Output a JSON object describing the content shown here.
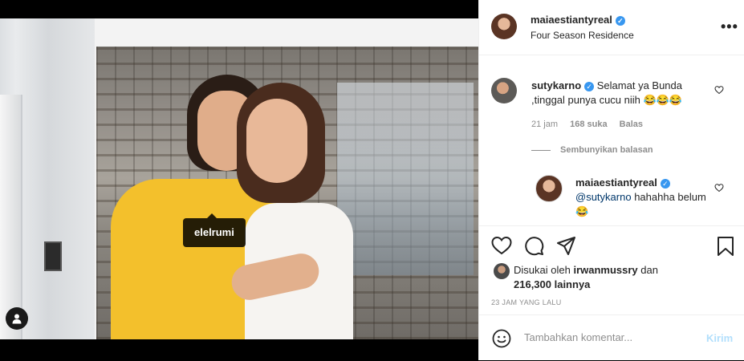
{
  "photo": {
    "tag_label": "elelrumi"
  },
  "header": {
    "username": "maiaestiantyreal",
    "location": "Four Season Residence",
    "more": "•••"
  },
  "comment": {
    "username": "sutykarno",
    "text": "Selamat ya Bunda ,tinggal punya cucu niih 😂😂😂",
    "time": "21 jam",
    "likes": "168 suka",
    "reply": "Balas"
  },
  "hide_replies": "Sembunyikan balasan",
  "reply": {
    "username": "maiaestiantyreal",
    "mention": "@sutykarno",
    "text": "hahahha belum 😂"
  },
  "likes": {
    "prefix": "Disukai oleh",
    "user": "irwanmussry",
    "and": "dan",
    "count": "216,300 lainnya"
  },
  "timestamp": "23 JAM YANG LALU",
  "comment_box": {
    "placeholder": "Tambahkan komentar...",
    "post_label": "Kirim"
  },
  "colors": {
    "verified": "#3897f0",
    "post_disabled": "#b2dffc",
    "mention": "#00376b"
  }
}
